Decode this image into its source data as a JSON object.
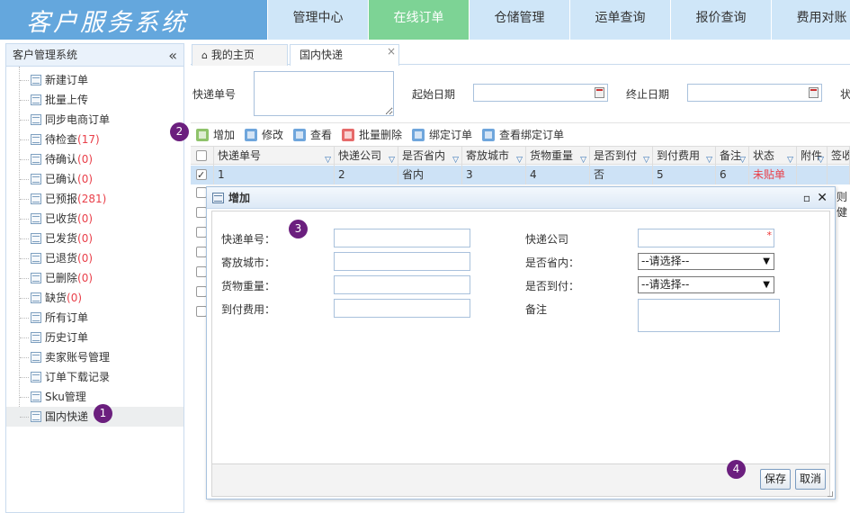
{
  "header": {
    "logo": "客户服务系统",
    "nav": [
      "管理中心",
      "在线订单",
      "仓储管理",
      "运单查询",
      "报价查询",
      "费用对账"
    ]
  },
  "sidebar": {
    "title": "客户管理系统",
    "collapse": "«",
    "items": [
      {
        "label": "新建订单",
        "count": ""
      },
      {
        "label": "批量上传",
        "count": ""
      },
      {
        "label": "同步电商订单",
        "count": ""
      },
      {
        "label": "待检查",
        "count": "(17)"
      },
      {
        "label": "待确认",
        "count": "(0)"
      },
      {
        "label": "已确认",
        "count": "(0)"
      },
      {
        "label": "已预报",
        "count": "(281)"
      },
      {
        "label": "已收货",
        "count": "(0)"
      },
      {
        "label": "已发货",
        "count": "(0)"
      },
      {
        "label": "已退货",
        "count": "(0)"
      },
      {
        "label": "已删除",
        "count": "(0)"
      },
      {
        "label": "缺货",
        "count": "(0)"
      },
      {
        "label": "所有订单",
        "count": ""
      },
      {
        "label": "历史订单",
        "count": ""
      },
      {
        "label": "卖家账号管理",
        "count": ""
      },
      {
        "label": "订单下载记录",
        "count": ""
      },
      {
        "label": "Sku管理",
        "count": ""
      },
      {
        "label": "国内快递",
        "count": ""
      }
    ]
  },
  "tabs": {
    "home": "我的主页",
    "active": "国内快递",
    "close": "×",
    "home_icon": "home-icon"
  },
  "search": {
    "tracking_label": "快递单号",
    "start_label": "起始日期",
    "end_label": "终止日期",
    "status_label": "状"
  },
  "toolbar": {
    "add": "增加",
    "edit": "修改",
    "view": "查看",
    "batch_delete": "批量删除",
    "bind": "绑定订单",
    "view_bind": "查看绑定订单"
  },
  "grid": {
    "columns": [
      "快递单号",
      "快递公司",
      "是否省内",
      "寄放城市",
      "货物重量",
      "是否到付",
      "到付费用",
      "备注",
      "状态",
      "附件",
      "签收"
    ],
    "row": [
      "1",
      "2",
      "省内",
      "3",
      "4",
      "否",
      "5",
      "6",
      "未贴单",
      "",
      ""
    ],
    "partial_text": "则健"
  },
  "dialog": {
    "title": "增加",
    "max": "▫",
    "close": "✕",
    "fields": {
      "tracking_no": "快递单号：",
      "company": "快递公司",
      "city": "寄放城市：",
      "in_province": "是否省内：",
      "weight": "货物重量：",
      "cod": "是否到付：",
      "cod_fee": "到付费用：",
      "remark": "备注"
    },
    "select_placeholder": "--请选择--",
    "required_mark": "*",
    "save": "保存",
    "cancel": "取消"
  },
  "badges": [
    "1",
    "2",
    "3",
    "4"
  ],
  "colors": {
    "logo_bg": "#64a7dd",
    "nav_bg": "#cfe6f8",
    "nav_active": "#7dd395",
    "badge": "#6b1f7e",
    "count_red": "#e9404a",
    "row_selected": "#cde2f6"
  }
}
